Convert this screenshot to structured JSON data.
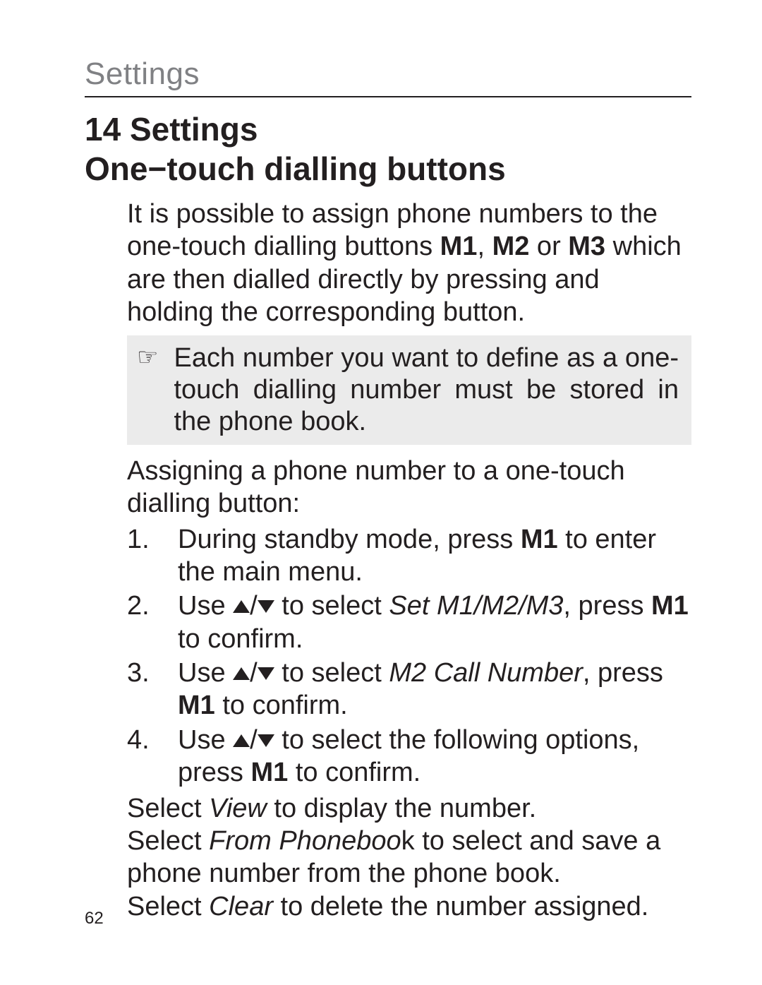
{
  "runningHead": "Settings",
  "chapterTitle": "14 Settings",
  "sectionTitle": "One−touch dialling buttons",
  "intro": {
    "pre": "It is possible to assign phone numbers to the one-touch dialling buttons ",
    "m1": "M1",
    "sep1": ", ",
    "m2": "M2",
    "sep2": " or ",
    "m3": "M3",
    "post": " which are then dialled directly by pressing and holding the corresponding button."
  },
  "note": "Each number you want to define as a one-touch dialling number must be stored in the phone book.",
  "lead": "Assigning a phone number to a one-touch dialling button:",
  "step1": {
    "a": "During standby mode, press ",
    "b": "M1",
    "c": " to enter the main menu."
  },
  "step2": {
    "a": "Use ",
    "b": " to select ",
    "c": "Set M1/M2/M3",
    "d": ", press ",
    "e": "M1",
    "f": " to confirm."
  },
  "step3": {
    "a": "Use ",
    "b": " to select ",
    "c": "M2 Call Number",
    "d": ", press ",
    "e": "M1",
    "f": " to confirm."
  },
  "step4": {
    "a": "Use ",
    "b": " to select the following options, press ",
    "c": "M1",
    "d": " to confirm."
  },
  "sel1": {
    "a": "Select ",
    "b": "View",
    "c": " to display the number."
  },
  "sel2": {
    "a": "Select ",
    "b": "From Phoneboo",
    "c": "k to select and save a phone number from the phone book."
  },
  "sel3": {
    "a": "Select ",
    "b": "Clear",
    "c": " to delete the number assigned."
  },
  "pageNumber": "62",
  "slash": "/"
}
